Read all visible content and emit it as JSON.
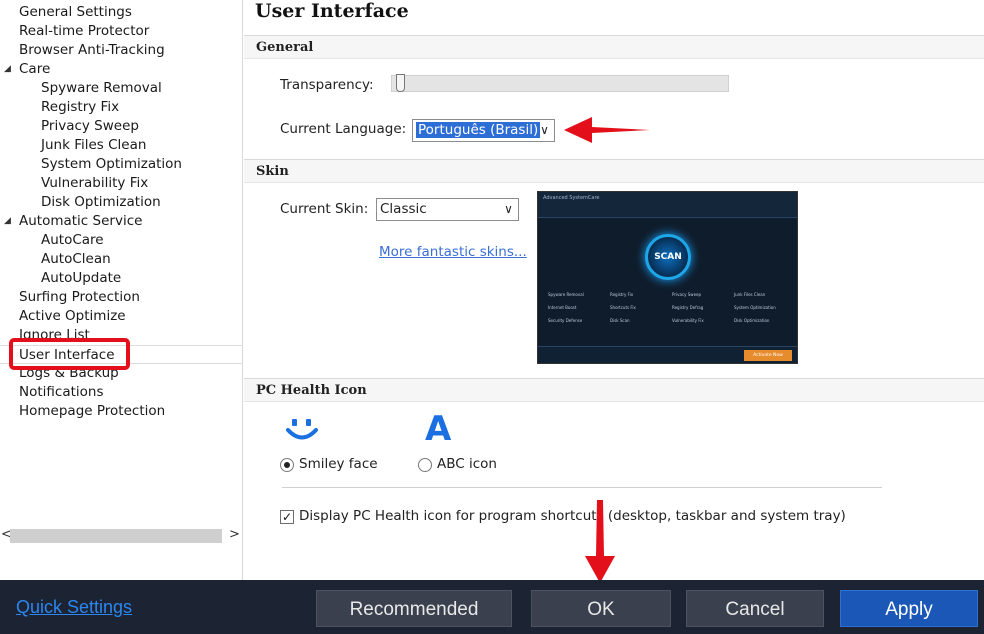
{
  "sidebar": {
    "items": [
      {
        "label": "General Settings",
        "level": 0
      },
      {
        "label": "Real-time Protector",
        "level": 0
      },
      {
        "label": "Browser Anti-Tracking",
        "level": 0
      },
      {
        "label": "Care",
        "level": 0,
        "expandable": true
      },
      {
        "label": "Spyware Removal",
        "level": 1
      },
      {
        "label": "Registry Fix",
        "level": 1
      },
      {
        "label": "Privacy Sweep",
        "level": 1
      },
      {
        "label": "Junk Files Clean",
        "level": 1
      },
      {
        "label": "System Optimization",
        "level": 1
      },
      {
        "label": "Vulnerability Fix",
        "level": 1
      },
      {
        "label": "Disk Optimization",
        "level": 1
      },
      {
        "label": "Automatic Service",
        "level": 0,
        "expandable": true
      },
      {
        "label": "AutoCare",
        "level": 1
      },
      {
        "label": "AutoClean",
        "level": 1
      },
      {
        "label": "AutoUpdate",
        "level": 1
      },
      {
        "label": "Surfing Protection",
        "level": 0
      },
      {
        "label": "Active Optimize",
        "level": 0
      },
      {
        "label": "Ignore List",
        "level": 0
      },
      {
        "label": "User Interface",
        "level": 0,
        "selected": true
      },
      {
        "label": "Logs & Backup",
        "level": 0
      },
      {
        "label": "Notifications",
        "level": 0
      },
      {
        "label": "Homepage Protection",
        "level": 0
      }
    ],
    "scroll_left": "<",
    "scroll_right": ">"
  },
  "main": {
    "title": "User Interface",
    "general": {
      "header": "General",
      "transparency_label": "Transparency:",
      "transparency_level": 0.0,
      "language_label": "Current Language:",
      "language_value": "Português (Brasil)"
    },
    "skin": {
      "header": "Skin",
      "current_skin_label": "Current Skin:",
      "current_skin_value": "Classic",
      "more_skins_link": "More fantastic skins...",
      "preview": {
        "app_title": "Advanced SystemCare",
        "scan_label": "SCAN",
        "items": [
          "Spyware Removal",
          "Registry Fix",
          "Privacy Sweep",
          "Junk Files Clean",
          "Internet Boost",
          "Shortcuts Fix",
          "Registry Defrag",
          "System Optimization",
          "Security Defense",
          "Disk Scan",
          "Vulnerability Fix",
          "Disk Optimization"
        ],
        "activate_label": "Activate Now"
      }
    },
    "pc_health": {
      "header": "PC Health Icon",
      "smiley_label": "Smiley face",
      "abc_label": "ABC icon",
      "abc_glyph": "A",
      "selected": "smiley",
      "display_checkbox_label": "Display PC Health icon for program shortcuts (desktop, taskbar and system tray)",
      "display_checked": true
    }
  },
  "footer": {
    "quick_settings": "Quick Settings",
    "recommended": "Recommended",
    "ok": "OK",
    "cancel": "Cancel",
    "apply": "Apply"
  },
  "colors": {
    "accent_blue": "#1a57b7",
    "highlight_red": "#e3101b",
    "footer_bg": "#1c2434",
    "link_blue": "#3a6fd3"
  }
}
